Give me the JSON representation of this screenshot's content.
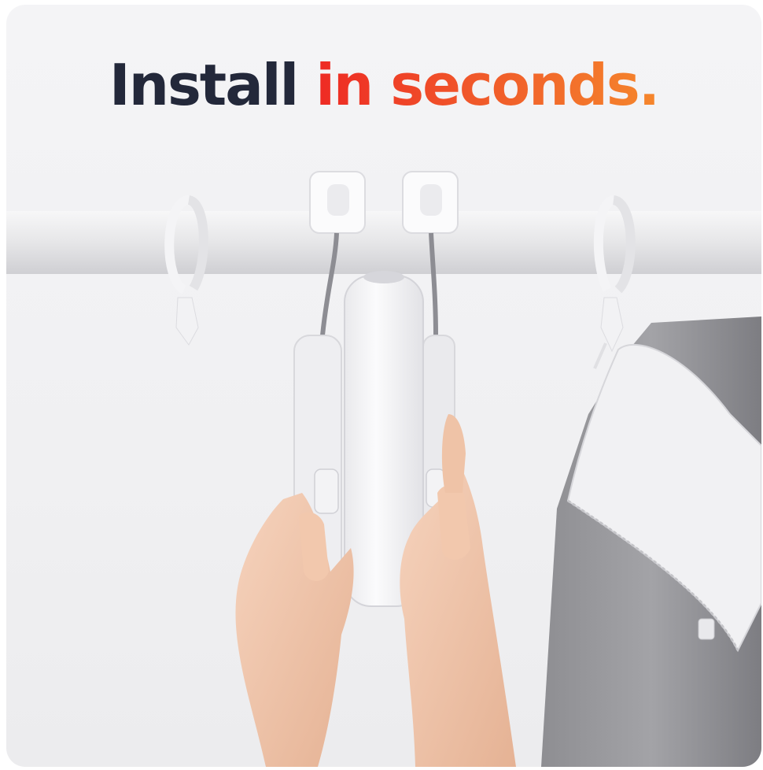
{
  "headline": {
    "part1": "Install",
    "part2": "in seconds."
  },
  "colors": {
    "headline_dark": "#23283a",
    "headline_gradient_start": "#ee2a24",
    "headline_gradient_end": "#f5862c",
    "background": "#f2f2f4"
  },
  "illustration": {
    "subject": "hands installing white curtain-motor device onto a curtain rod",
    "elements": [
      "curtain-rod",
      "curtain-ring",
      "device-hook",
      "curtain-motor-device",
      "left-hand",
      "right-hand",
      "grey-curtain"
    ]
  }
}
